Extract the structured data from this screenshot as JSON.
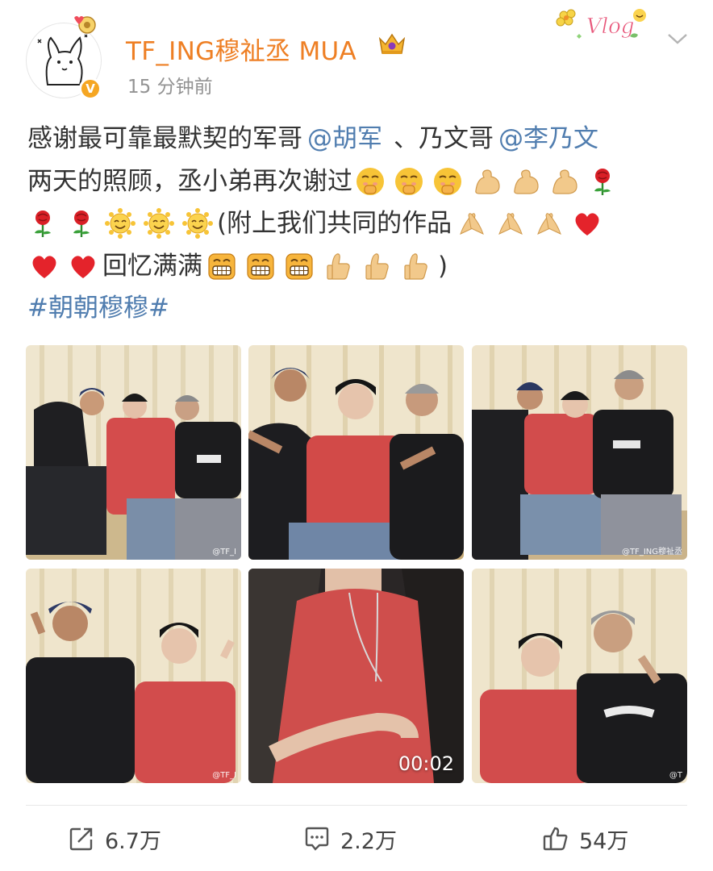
{
  "header": {
    "username": "TF_ING穆祉丞 MUA",
    "timestamp": "15 分钟前",
    "verified_badge": "V",
    "vlog_sticker": "Vlog"
  },
  "post": {
    "line1": {
      "text": "感谢最可靠最默契的军哥",
      "mention1": "@胡军",
      "sep": "、乃文哥",
      "mention2": "@李乃文"
    },
    "line2": {
      "text": "两天的照顾，丞小弟再次谢过"
    },
    "line3": {
      "text": "(附上我们共同的作品"
    },
    "line4": {
      "text": "回忆满满",
      "close": ")"
    },
    "hashtag": "#朝朝穆穆#"
  },
  "photos": [
    {
      "name": "photo-1",
      "watermark": "@TF_I"
    },
    {
      "name": "photo-2",
      "watermark": ""
    },
    {
      "name": "photo-3",
      "watermark": "@TF_ING穆祉丞"
    },
    {
      "name": "photo-4",
      "watermark": "@TF_I"
    },
    {
      "name": "photo-5",
      "video_duration": "00:02"
    },
    {
      "name": "photo-6",
      "watermark": "@T"
    }
  ],
  "stats": {
    "repost": "6.7万",
    "comment": "2.2万",
    "like": "54万"
  },
  "icons": [
    "share-icon",
    "comment-icon",
    "like-icon",
    "chevron-down-icon",
    "crown-icon"
  ],
  "colors": {
    "username": "#ee7f24",
    "link": "#507daf",
    "meta": "#939393"
  }
}
